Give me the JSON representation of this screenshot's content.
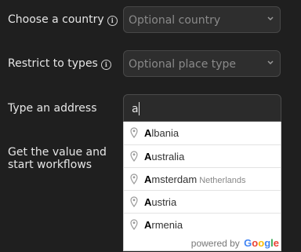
{
  "fields": {
    "country": {
      "label": "Choose a country",
      "placeholder": "Optional country"
    },
    "types": {
      "label": "Restrict to types",
      "placeholder": "Optional place type"
    },
    "address": {
      "label": "Type an address",
      "value": "a"
    },
    "workflow": {
      "label_line1": "Get the value and",
      "label_line2": "start workflows"
    }
  },
  "autocomplete": {
    "items": [
      {
        "match": "A",
        "rest": "lbania",
        "secondary": ""
      },
      {
        "match": "A",
        "rest": "ustralia",
        "secondary": ""
      },
      {
        "match": "A",
        "rest": "msterdam",
        "secondary": "Netherlands"
      },
      {
        "match": "A",
        "rest": "ustria",
        "secondary": ""
      },
      {
        "match": "A",
        "rest": "rmenia",
        "secondary": ""
      }
    ],
    "powered_by": "powered by",
    "brand": [
      "G",
      "o",
      "o",
      "g",
      "l",
      "e"
    ]
  },
  "icons": {
    "info": "info-icon",
    "chevron": "chevron-down-icon",
    "pin": "map-pin-icon"
  }
}
